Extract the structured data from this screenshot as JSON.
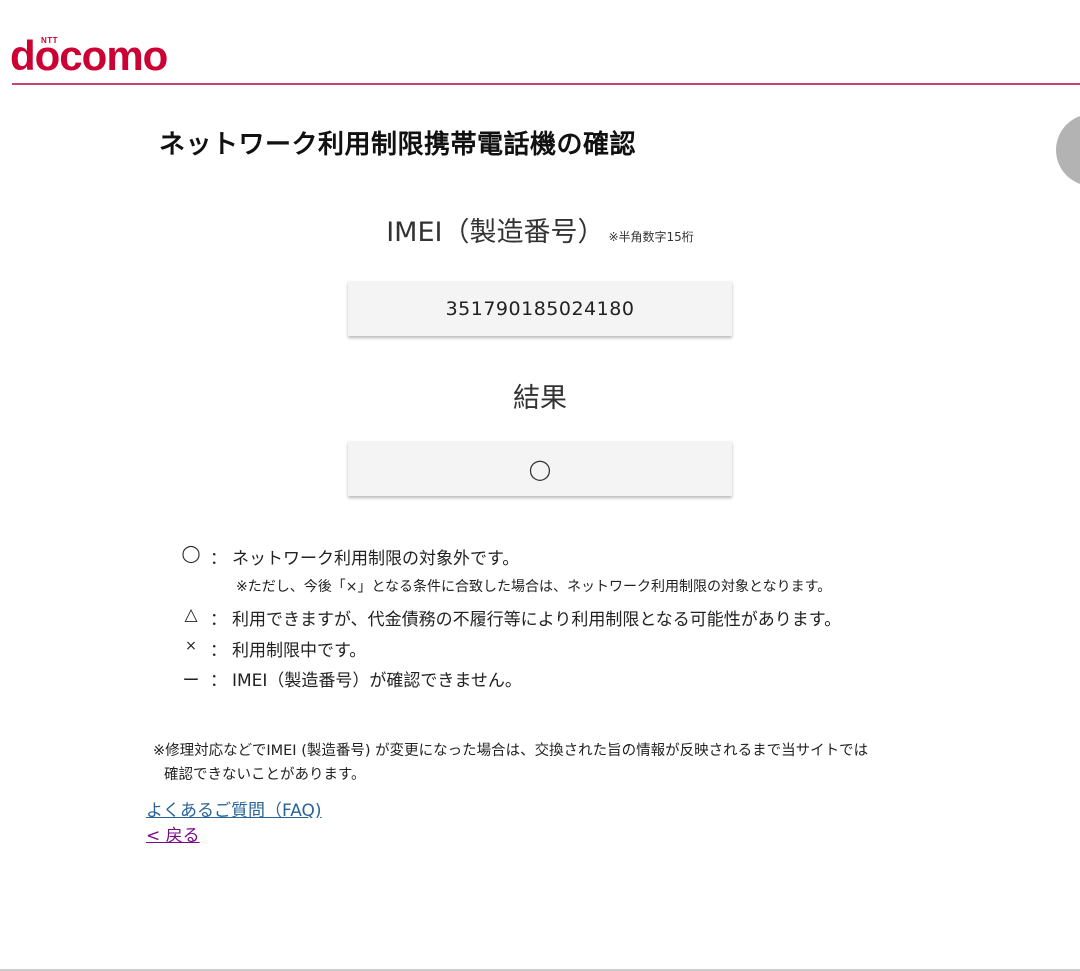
{
  "header": {
    "logo_top": "NTT",
    "logo_word": "docomo"
  },
  "page": {
    "title": "ネットワーク利用制限携帯電話機の確認"
  },
  "imei": {
    "label": "IMEI（製造番号）",
    "note": "※半角数字15桁",
    "value": "351790185024180"
  },
  "result": {
    "label": "結果",
    "value": "◯"
  },
  "legend": [
    {
      "symbol": "◯",
      "colon": "：",
      "text": "ネットワーク利用制限の対象外です。",
      "sub": "※ただし、今後「×」となる条件に合致した場合は、ネットワーク利用制限の対象となります。"
    },
    {
      "symbol": "△",
      "colon": "：",
      "text": "利用できますが、代金債務の不履行等により利用制限となる可能性があります。"
    },
    {
      "symbol": "×",
      "colon": "：",
      "text": "利用制限中です。"
    },
    {
      "symbol": "ー",
      "colon": "：",
      "text": "IMEI（製造番号）が確認できません。"
    }
  ],
  "footnote": {
    "line1": "※修理対応などでIMEI (製造番号) が変更になった場合は、交換された旨の情報が反映されるまで当サイトでは",
    "line2": "確認できないことがあります。"
  },
  "links": {
    "faq": "よくあるご質問（FAQ)",
    "back": "< 戻る"
  },
  "colors": {
    "brand": "#cc0033",
    "header_rule": "#c8466e",
    "link": "#2a6496",
    "link_visited": "#7a0a8a"
  }
}
